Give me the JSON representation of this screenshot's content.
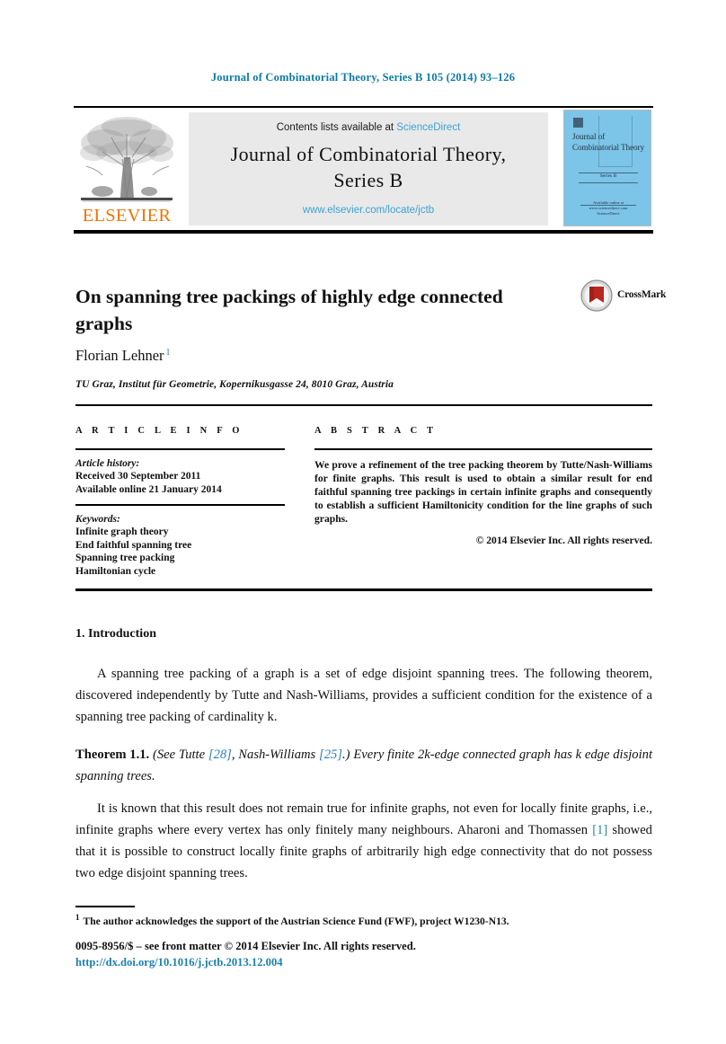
{
  "running_head": "Journal of Combinatorial Theory, Series B 105 (2014) 93–126",
  "colors": {
    "link_blue": "#2b7fb5",
    "header_blue": "#0b7ba6",
    "sciencedirect_blue": "#3aa3d4",
    "elsevier_orange": "#ec7404",
    "cover_blue": "#7cc4e8",
    "masthead_grey": "#e9e9e9"
  },
  "masthead": {
    "contents_prefix": "Contents lists available at ",
    "contents_link": "ScienceDirect",
    "journal_title_line1": "Journal of Combinatorial Theory,",
    "journal_title_line2": "Series B",
    "journal_url": "www.elsevier.com/locate/jctb",
    "publisher_wordmark": "ELSEVIER",
    "cover": {
      "title": "Journal of Combinatorial Theory",
      "series_label": "Series B",
      "footer_line1": "Available online at www.sciencedirect.com",
      "footer_line2": "ScienceDirect"
    }
  },
  "article": {
    "title": "On spanning tree packings of highly edge connected graphs",
    "author": "Florian Lehner",
    "author_footnote_marker": "1",
    "affiliation": "TU Graz, Institut für Geometrie, Kopernikusgasse 24, 8010 Graz, Austria",
    "crossmark_label": "CrossMark"
  },
  "info": {
    "heading": "A R T I C L E   I N F O",
    "history_label": "Article history:",
    "history_lines": [
      "Received 30 September 2011",
      "Available online 21 January 2014"
    ],
    "keywords_label": "Keywords:",
    "keywords": [
      "Infinite graph theory",
      "End faithful spanning tree",
      "Spanning tree packing",
      "Hamiltonian cycle"
    ]
  },
  "abstract": {
    "heading": "A B S T R A C T",
    "body": "We prove a refinement of the tree packing theorem by Tutte/Nash-Williams for finite graphs. This result is used to obtain a similar result for end faithful spanning tree packings in certain infinite graphs and consequently to establish a sufficient Hamiltonicity condition for the line graphs of such graphs.",
    "copyright": "© 2014 Elsevier Inc. All rights reserved."
  },
  "body": {
    "section_number_title": "1.  Introduction",
    "paragraph_1": "A spanning tree packing of a graph is a set of edge disjoint spanning trees. The following theorem, discovered independently by Tutte and Nash-Williams, provides a sufficient condition for the existence of a spanning tree packing of cardinality k.",
    "theorem": {
      "label": "Theorem 1.1.",
      "attribution_pre": "(See Tutte ",
      "citation_1": "[28]",
      "attribution_mid": ", Nash-Williams ",
      "citation_2": "[25]",
      "attribution_post": ".)",
      "statement_1": "Every finite 2k-edge connected graph has k edge disjoint spanning trees."
    },
    "paragraph_2_pre": "It is known that this result does not remain true for infinite graphs, not even for locally finite graphs, i.e., infinite graphs where every vertex has only finitely many neighbours. Aharoni and Thomassen ",
    "paragraph_2_citation": "[1]",
    "paragraph_2_post": " showed that it is possible to construct locally finite graphs of arbitrarily high edge connectivity that do not possess two edge disjoint spanning trees."
  },
  "footer": {
    "footnote_marker": "1",
    "footnote_text": "The author acknowledges the support of the Austrian Science Fund (FWF), project W1230-N13.",
    "issn_line": "0095-8956/$ – see front matter  © 2014 Elsevier Inc. All rights reserved.",
    "doi": "http://dx.doi.org/10.1016/j.jctb.2013.12.004"
  }
}
